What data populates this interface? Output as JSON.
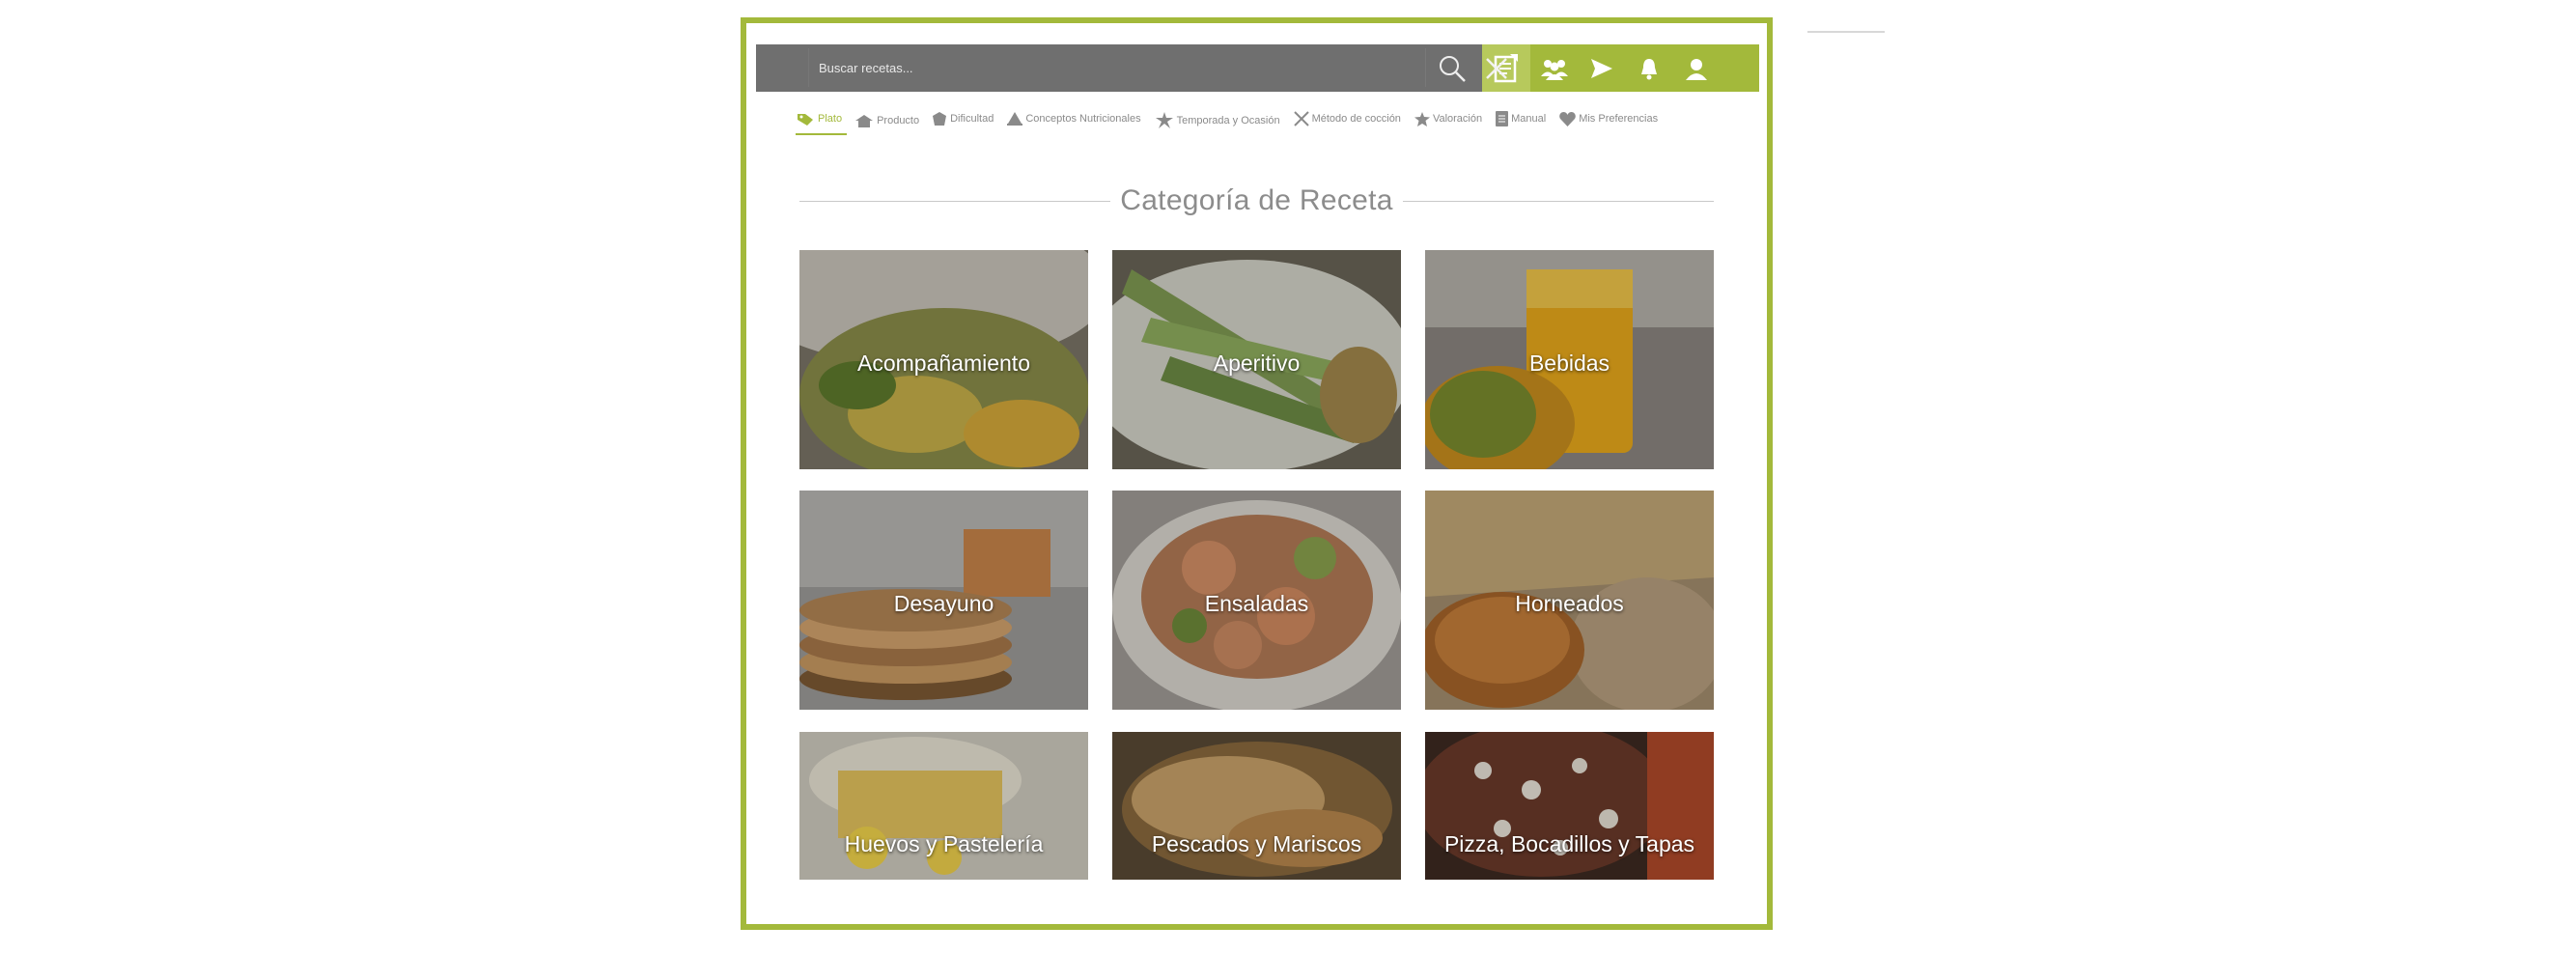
{
  "search": {
    "placeholder": "Buscar recetas..."
  },
  "header_actions": [
    "recipes-icon",
    "community-icon",
    "send-icon",
    "notifications-icon",
    "user-icon"
  ],
  "nav": {
    "items": [
      {
        "label": "Plato",
        "icon": "tag-icon"
      },
      {
        "label": "Producto",
        "icon": "product-icon"
      },
      {
        "label": "Dificultad",
        "icon": "difficulty-icon"
      },
      {
        "label": "Conceptos Nutricionales",
        "icon": "nutrition-icon"
      },
      {
        "label": "Temporada y Ocasión",
        "icon": "season-icon"
      },
      {
        "label": "Método de cocción",
        "icon": "utensils-icon"
      },
      {
        "label": "Valoración",
        "icon": "star-icon"
      },
      {
        "label": "Manual",
        "icon": "manual-icon"
      },
      {
        "label": "Mis Preferencias",
        "icon": "heart-icon"
      }
    ],
    "active": "Plato"
  },
  "section": {
    "title": "Categoría de Receta"
  },
  "categories": [
    {
      "label": "Acompañamiento"
    },
    {
      "label": "Aperitivo"
    },
    {
      "label": "Bebidas"
    },
    {
      "label": "Desayuno"
    },
    {
      "label": "Ensaladas"
    },
    {
      "label": "Horneados"
    },
    {
      "label": "Huevos y Pastelería"
    },
    {
      "label": "Pescados y Mariscos"
    },
    {
      "label": "Pizza, Bocadillos y Tapas"
    }
  ],
  "colors": {
    "accent": "#a3b93b",
    "header": "#6f6f6f"
  }
}
